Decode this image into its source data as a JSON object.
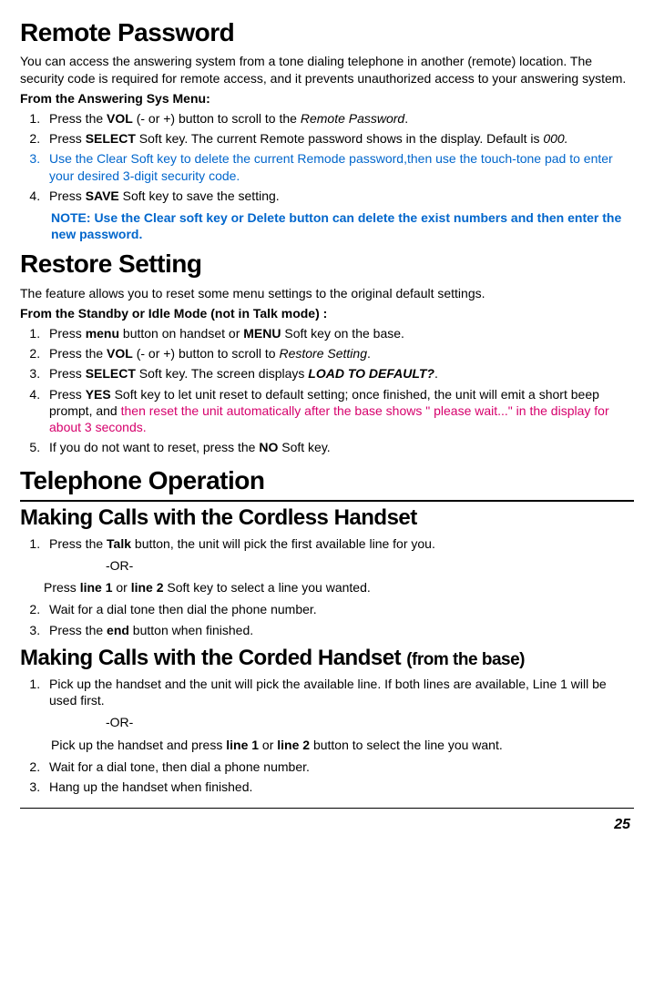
{
  "remote_password": {
    "title": "Remote Password",
    "intro": "You can access the answering system from a tone dialing telephone in another (remote) location. The security code is required for remote access, and it prevents unauthorized access to your answering system.",
    "menu_label": "From the Answering Sys Menu:",
    "s1_a": "Press the ",
    "s1_b": "VOL",
    "s1_c": " (- or +) button to scroll to the ",
    "s1_d": "Remote Password",
    "s1_e": ".",
    "s2_a": "Press ",
    "s2_b": "SELECT",
    "s2_c": " Soft key. The current Remote password shows in the display. Default is ",
    "s2_d": "000.",
    "s3": "Use the Clear Soft key to delete the current Remode password,then use the touch-tone pad to enter your desired 3-digit security code.",
    "s4_a": "Press ",
    "s4_b": "SAVE",
    "s4_c": " Soft key to save the setting.",
    "note": "NOTE: Use the Clear soft key or Delete button can delete the exist numbers and then enter the new password."
  },
  "restore": {
    "title": "Restore Setting",
    "intro": "The feature allows you to reset some menu settings to the original default settings.",
    "mode_a": "From the ",
    "mode_b": "Standby or Idle Mode (not in Talk mode) :",
    "s1_a": "Press ",
    "s1_b": "menu",
    "s1_c": " button on handset or ",
    "s1_d": "MENU",
    "s1_e": " Soft key on the base.",
    "s2_a": "Press the ",
    "s2_b": "VOL",
    "s2_c": " (- or +) button to scroll to ",
    "s2_d": "Restore Setting",
    "s2_e": ".",
    "s3_a": "Press ",
    "s3_b": "SELECT",
    "s3_c": " Soft key. The screen displays ",
    "s3_d": "LOAD TO DEFAULT?",
    "s3_e": ".",
    "s4_a": "Press ",
    "s4_b": "YES",
    "s4_c": " Soft key to let unit reset to default setting; once finished, the unit will emit a short beep prompt, and ",
    "s4_d": "then reset the unit automatically after the base shows \" please wait...\" in the display for about 3 seconds.",
    "s5_a": "If you do not want to reset, press the ",
    "s5_b": "NO",
    "s5_c": " Soft key."
  },
  "telop": {
    "title": "Telephone Operation",
    "cordless": {
      "title": "Making Calls with the Cordless Handset",
      "s1_a": "Press the ",
      "s1_b": "Talk",
      "s1_c": " button, the unit will pick the first available line for you.",
      "or": "-OR-",
      "s1alt_a": "Press ",
      "s1alt_b": "line 1",
      "s1alt_c": " or ",
      "s1alt_d": "line 2",
      "s1alt_e": " Soft key to select a line you wanted.",
      "s2": "Wait for a dial tone then dial the phone number.",
      "s3_a": "Press the ",
      "s3_b": "end",
      "s3_c": " button when finished."
    },
    "corded": {
      "title_a": "Making Calls with the Corded Handset ",
      "title_b": "(from the base)",
      "s1": "Pick up the handset and the unit will pick the available line. If both lines are available, Line 1 will be used first.",
      "or": "-OR-",
      "s1alt_a": "Pick up the handset and press ",
      "s1alt_b": "line 1",
      "s1alt_c": " or ",
      "s1alt_d": "line 2",
      "s1alt_e": " button to select the line you want.",
      "s2": "Wait for a dial tone, then dial a phone number.",
      "s3": "Hang up the handset when finished."
    }
  },
  "page": "25"
}
